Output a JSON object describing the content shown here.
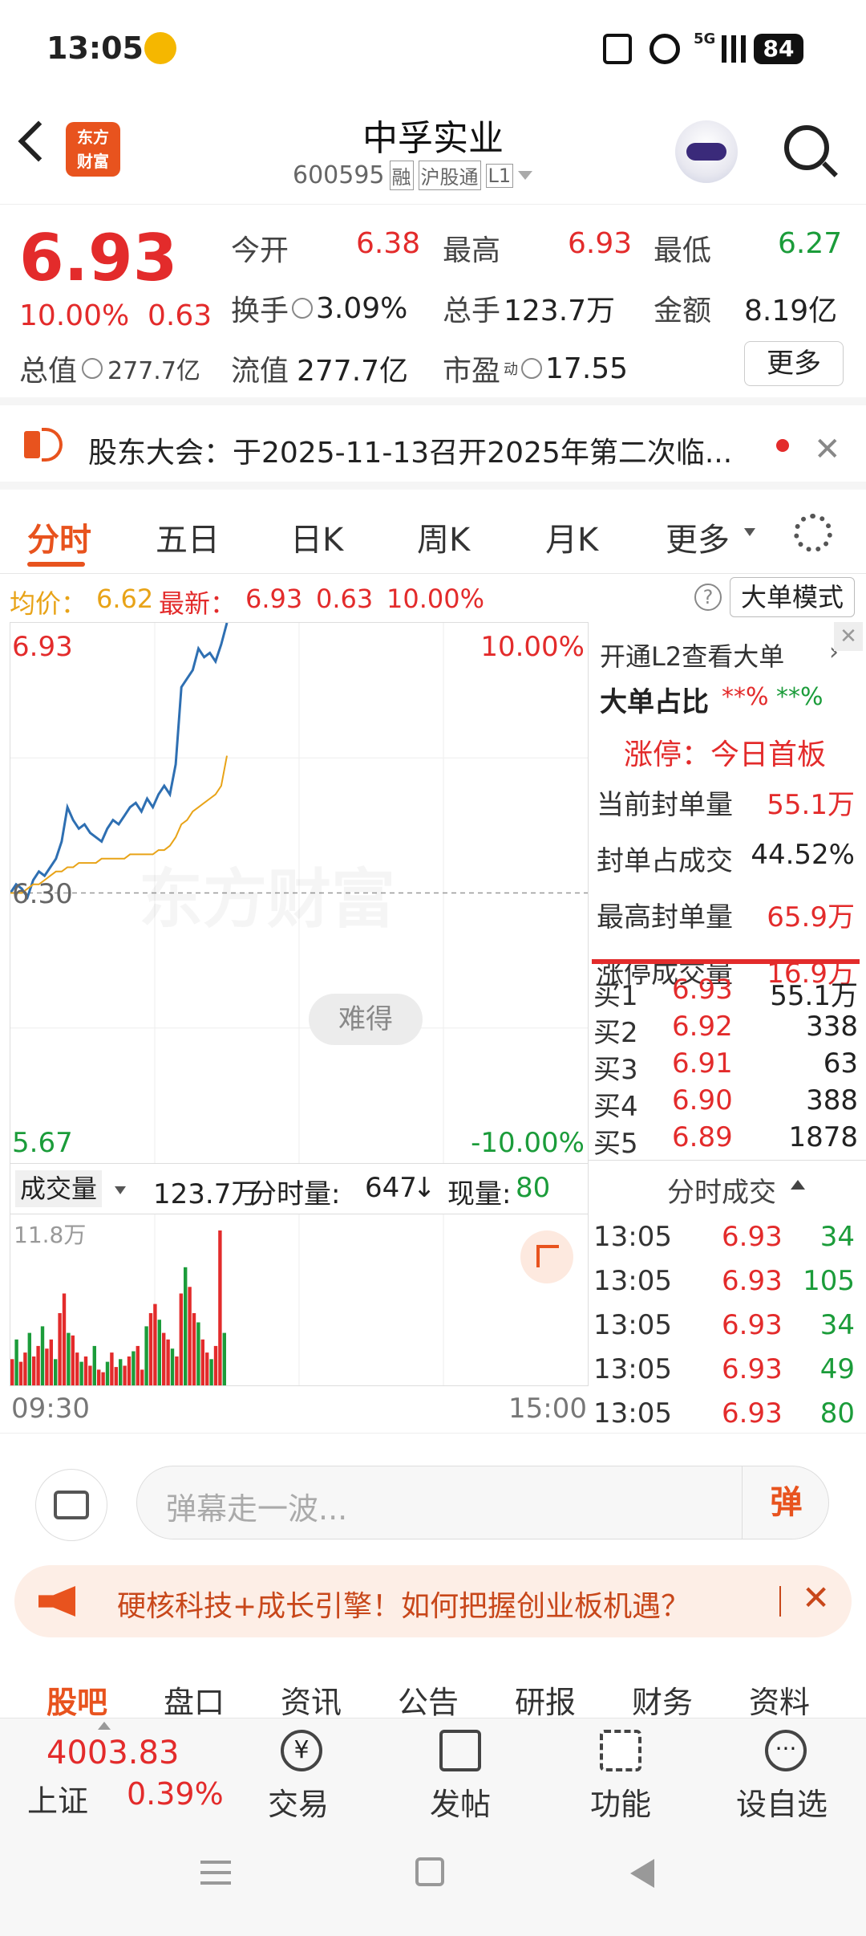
{
  "status": {
    "time": "13:05",
    "signal": "5G",
    "battery": "84"
  },
  "header": {
    "name": "中孚实业",
    "code": "600595",
    "tags": [
      "融",
      "沪股通",
      "L1"
    ],
    "logo_line1": "东方",
    "logo_line2": "财富"
  },
  "quote": {
    "price": "6.93",
    "change_pct": "10.00%",
    "change": "0.63",
    "open_label": "今开",
    "open": "6.38",
    "high_label": "最高",
    "high": "6.93",
    "low_label": "最低",
    "low": "6.27",
    "turnover_label": "换手",
    "turnover": "3.09%",
    "vol_label": "总手",
    "vol": "123.7万",
    "amount_label": "金额",
    "amount": "8.19亿",
    "mktcap_label": "总值",
    "mktcap": "277.7亿",
    "float_label": "流值",
    "float": "277.7亿",
    "pe_label": "市盈",
    "pe_sup": "动",
    "pe": "17.55",
    "more": "更多"
  },
  "notice": {
    "text": "股东大会：于2025-11-13召开2025年第二次临..."
  },
  "tabs": [
    "分时",
    "五日",
    "日K",
    "周K",
    "月K",
    "更多"
  ],
  "infobar": {
    "avg_label": "均价：",
    "avg": "6.62",
    "latest_label": "最新：",
    "latest": "6.93",
    "chg": "0.63",
    "pct": "10.00%",
    "mode": "大单模式"
  },
  "chart": {
    "top_price": "6.93",
    "top_pct": "10.00%",
    "mid_price": "6.30",
    "bot_price": "5.67",
    "bot_pct": "-10.00%",
    "watermark": "东方财富",
    "bubble": "难得"
  },
  "chart_data": {
    "type": "line",
    "x_start": "09:30",
    "x_end": "15:00",
    "ylim": [
      5.67,
      6.93
    ],
    "series": [
      {
        "name": "price",
        "values": [
          6.3,
          6.32,
          6.31,
          6.29,
          6.33,
          6.35,
          6.34,
          6.36,
          6.38,
          6.42,
          6.5,
          6.47,
          6.45,
          6.46,
          6.44,
          6.43,
          6.42,
          6.45,
          6.47,
          6.46,
          6.48,
          6.5,
          6.51,
          6.49,
          6.52,
          6.5,
          6.53,
          6.55,
          6.53,
          6.6,
          6.78,
          6.8,
          6.82,
          6.87,
          6.85,
          6.86,
          6.84,
          6.88,
          6.93
        ]
      },
      {
        "name": "avg",
        "values": [
          6.3,
          6.3,
          6.3,
          6.31,
          6.32,
          6.32,
          6.33,
          6.34,
          6.35,
          6.35,
          6.36,
          6.36,
          6.37,
          6.37,
          6.37,
          6.37,
          6.38,
          6.38,
          6.38,
          6.38,
          6.38,
          6.39,
          6.39,
          6.39,
          6.39,
          6.39,
          6.4,
          6.4,
          6.41,
          6.43,
          6.46,
          6.47,
          6.49,
          6.5,
          6.51,
          6.52,
          6.53,
          6.55,
          6.62
        ]
      }
    ]
  },
  "volume": {
    "label": "成交量",
    "total": "123.7万",
    "minute_label": "分时量:",
    "minute": "647",
    "now_label": "现量:",
    "now": "80",
    "max": "11.8万",
    "t_start": "09:30",
    "t_end": "15:00"
  },
  "volume_data": [
    20,
    35,
    18,
    25,
    40,
    22,
    30,
    45,
    28,
    35,
    20,
    55,
    70,
    40,
    38,
    25,
    18,
    22,
    15,
    30,
    12,
    10,
    18,
    25,
    14,
    20,
    15,
    22,
    26,
    30,
    12,
    45,
    55,
    62,
    50,
    40,
    35,
    28,
    22,
    70,
    90,
    75,
    55,
    48,
    35,
    25,
    20,
    30,
    118,
    40
  ],
  "side": {
    "l2": "开通L2查看大单",
    "big_ratio_label": "大单占比",
    "big_ratio_red": "**%",
    "big_ratio_green": "**%",
    "limit_title": "涨停：今日首板",
    "limit_rows": [
      {
        "label": "当前封单量",
        "value": "55.1万"
      },
      {
        "label": "封单占成交",
        "value": "44.52%"
      },
      {
        "label": "最高封单量",
        "value": "65.9万"
      },
      {
        "label": "涨停成交量",
        "value": "16.9万"
      }
    ],
    "bids": [
      {
        "label": "买1",
        "price": "6.93",
        "vol": "55.1万"
      },
      {
        "label": "买2",
        "price": "6.92",
        "vol": "338"
      },
      {
        "label": "买3",
        "price": "6.91",
        "vol": "63"
      },
      {
        "label": "买4",
        "price": "6.90",
        "vol": "388"
      },
      {
        "label": "买5",
        "price": "6.89",
        "vol": "1878"
      }
    ],
    "trades_title": "分时成交",
    "trades": [
      {
        "time": "13:05",
        "price": "6.93",
        "vol": "34"
      },
      {
        "time": "13:05",
        "price": "6.93",
        "vol": "105"
      },
      {
        "time": "13:05",
        "price": "6.93",
        "vol": "34"
      },
      {
        "time": "13:05",
        "price": "6.93",
        "vol": "49"
      },
      {
        "time": "13:05",
        "price": "6.93",
        "vol": "80"
      }
    ]
  },
  "danmu": {
    "placeholder": "弹幕走一波...",
    "send": "弹"
  },
  "banner": {
    "text": "硬核科技+成长引擎！如何把握创业板机遇？"
  },
  "subtabs": [
    "股吧",
    "盘口",
    "资讯",
    "公告",
    "研报",
    "财务",
    "资料"
  ],
  "bottom": {
    "index_value": "4003.83",
    "index_name": "上证",
    "index_pct": "0.39%",
    "items": [
      "交易",
      "发帖",
      "功能",
      "设自选"
    ]
  },
  "colors": {
    "up": "#e32b2b",
    "down": "#1b9c3a",
    "avg": "#e8a317",
    "accent": "#e8531e",
    "line": "#2e6fb2"
  }
}
